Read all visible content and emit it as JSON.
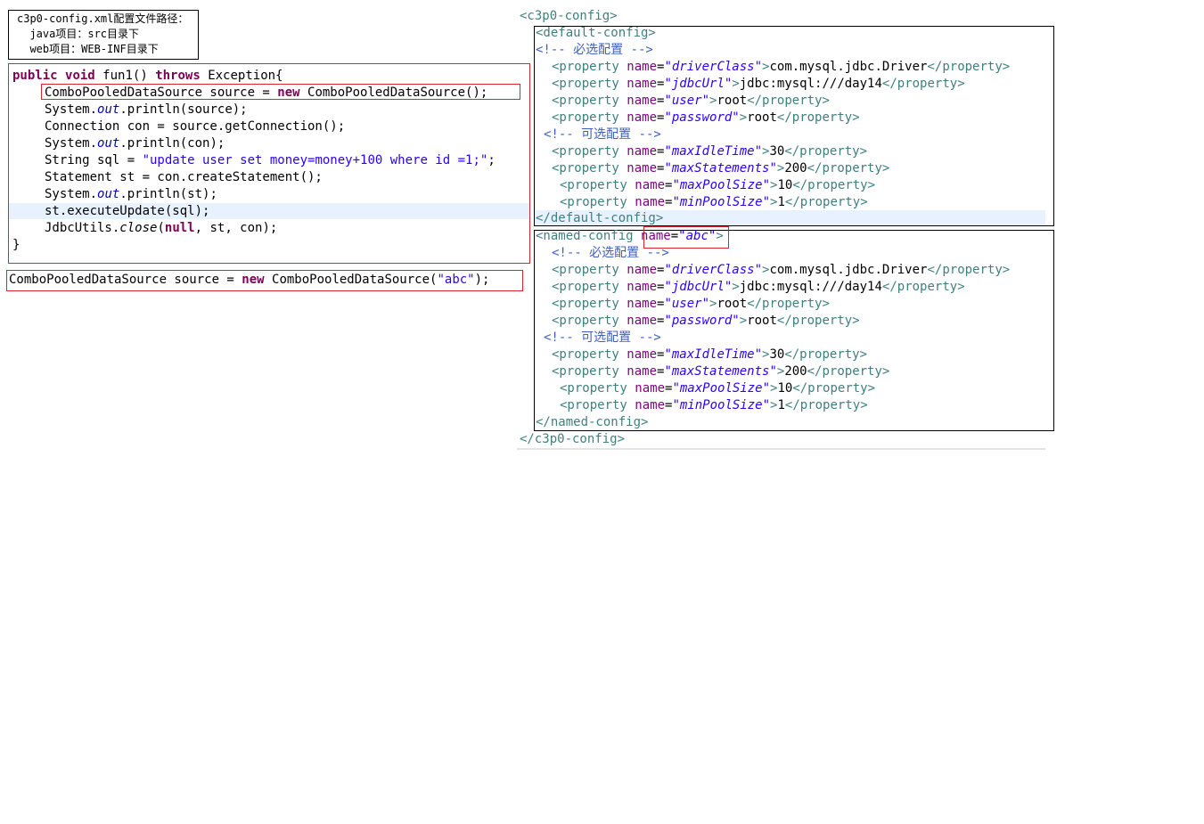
{
  "note": {
    "lines": [
      "c3p0-config.xml配置文件路径：",
      "  java项目：src目录下",
      "  web项目：WEB-INF目录下"
    ]
  },
  "java_code": {
    "method_header": {
      "public": "public",
      "void": "void",
      "name": "fun1() ",
      "throws": "throws",
      "rest": " Exception{"
    },
    "l1": {
      "a": "ComboPooledDataSource source = ",
      "new": "new",
      "b": " ComboPooledDataSource();"
    },
    "l2": {
      "a": "System.",
      "out": "out",
      "b": ".println(source);"
    },
    "l3": {
      "a": "Connection con = source.getConnection();"
    },
    "l4": {
      "a": "System.",
      "out": "out",
      "b": ".println(con);"
    },
    "l5": {
      "a": "String sql = ",
      "str": "\"update user set money=money+100 where id =1;\"",
      "b": ";"
    },
    "l6": {
      "a": "Statement st = con.createStatement();"
    },
    "l7": {
      "a": "System.",
      "out": "out",
      "b": ".println(st);"
    },
    "l8": {
      "a": "st.executeUpdate(sql);"
    },
    "l9": {
      "a": "JdbcUtils.",
      "close": "close",
      "b": "(",
      "null": "null",
      "c": ", st, con);"
    },
    "closing": "}"
  },
  "named_example": {
    "a": "ComboPooledDataSource source = ",
    "new": "new",
    "b": " ComboPooledDataSource(",
    "str": "\"abc\"",
    "c": ");"
  },
  "xml": {
    "root_open": "<c3p0-config>",
    "root_close": "</c3p0-config>",
    "default_open": "<default-config>",
    "default_close": "</default-config>",
    "named_open": "<named-config",
    "named_attr": "name",
    "named_eq": "=",
    "named_val": "\"abc\"",
    "named_gt": ">",
    "named_close": "</named-config>",
    "comment_required": "<!-- 必选配置 -->",
    "comment_optional": "<!-- 可选配置 -->",
    "property_open": "<property",
    "property_attr": "name",
    "property_close": "</property>",
    "eq": "=",
    "gt": ">",
    "props": [
      {
        "name": "\"driverClass\"",
        "value": "com.mysql.jdbc.Driver"
      },
      {
        "name": "\"jdbcUrl\"",
        "value": "jdbc:mysql:///day14"
      },
      {
        "name": "\"user\"",
        "value": "root"
      },
      {
        "name": "\"password\"",
        "value": "root"
      },
      {
        "name": "\"maxIdleTime\"",
        "value": "30"
      },
      {
        "name": "\"maxStatements\"",
        "value": "200"
      },
      {
        "name": "\"maxPoolSize\"",
        "value": "10"
      },
      {
        "name": "\"minPoolSize\"",
        "value": "1"
      }
    ]
  }
}
